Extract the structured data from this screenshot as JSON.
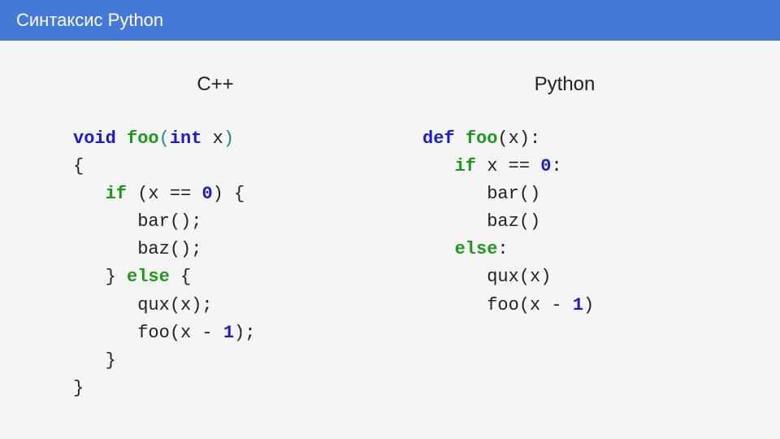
{
  "header": {
    "title": "Синтаксис Python"
  },
  "columns": {
    "cpp": {
      "title": "C++"
    },
    "py": {
      "title": "Python"
    }
  },
  "tokens": {
    "void": "void",
    "foo": "foo",
    "int": "int",
    "x": "x",
    "if": "if",
    "eqeq": " == ",
    "zero": "0",
    "bar": "bar();",
    "baz": "baz();",
    "else": "else",
    "qux": "qux(x);",
    "foox1a": "foo(x - ",
    "one": "1",
    "foox1b": ");",
    "lbrace": "{",
    "rbrace": "}",
    "rbrace_sp": "} ",
    "sp_lbrace": " {",
    "lparen": "(",
    "rparen": ")",
    "rparen_sp": ") ",
    "def": "def",
    "colon": ":",
    "xclose": "(x):",
    "eqeq_py": " == ",
    "bar_py": "bar()",
    "baz_py": "baz()",
    "qux_py": "qux(x)",
    "foox1a_py": "foo(x - ",
    "foox1b_py": ")"
  }
}
